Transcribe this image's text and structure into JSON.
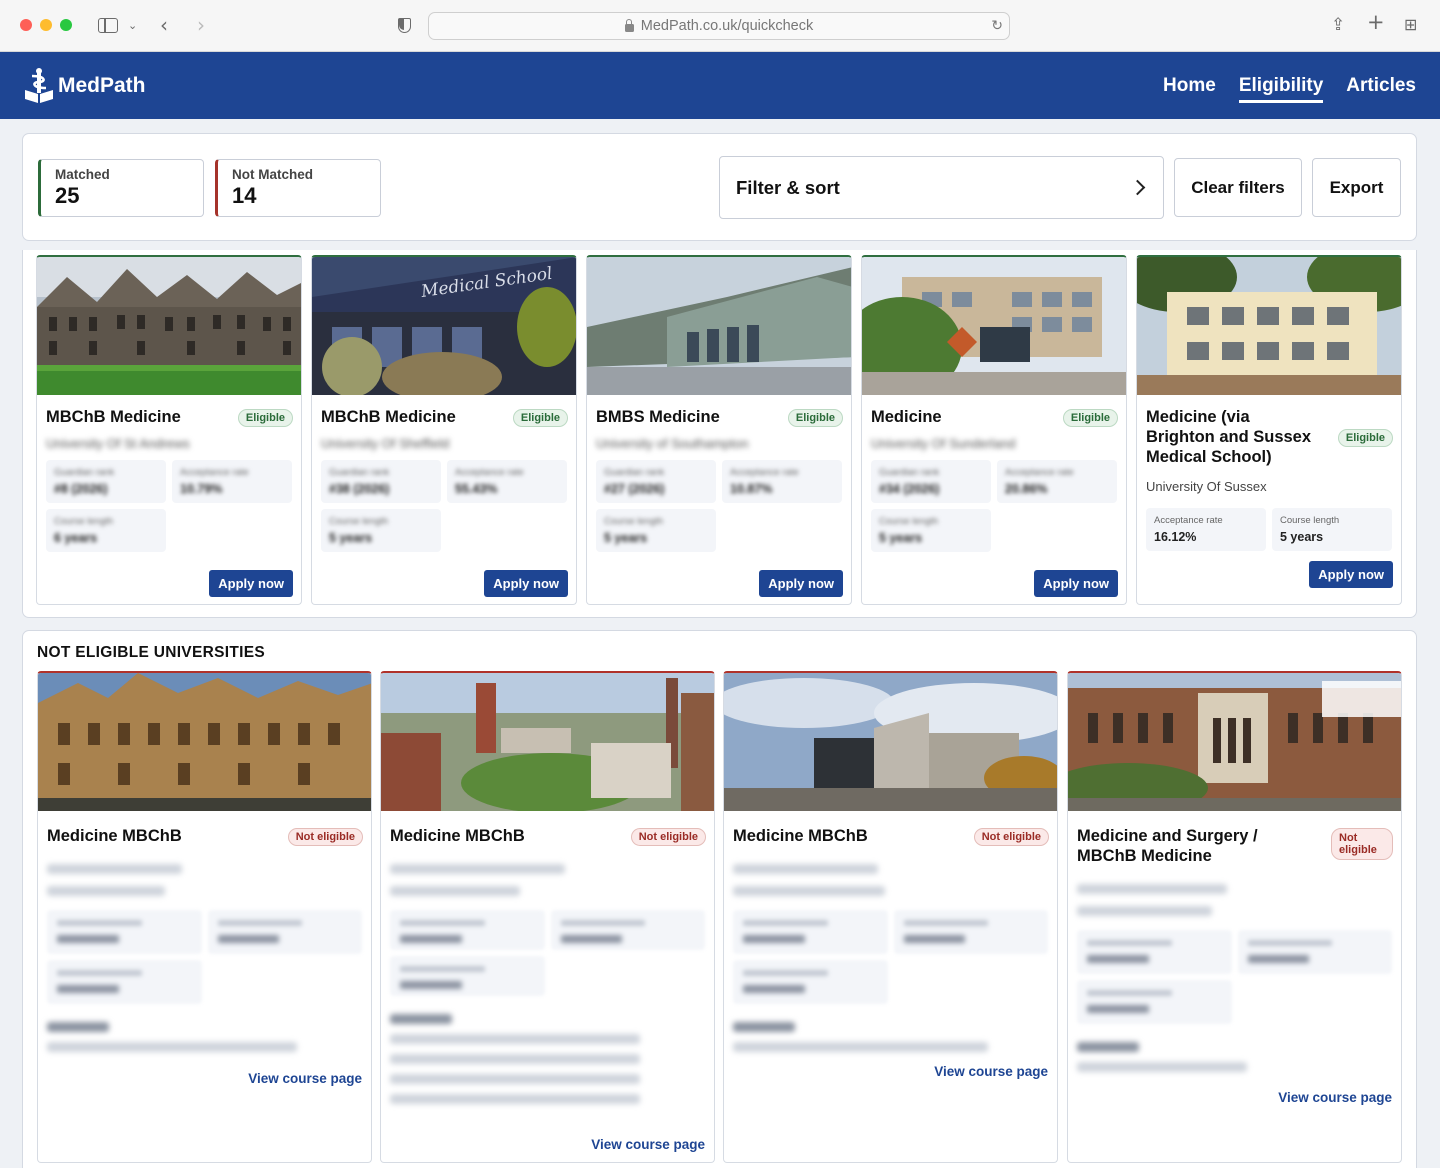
{
  "browser": {
    "url": "MedPath.co.uk/quickcheck"
  },
  "nav": {
    "brand": "MedPath",
    "links": [
      "Home",
      "Eligibility",
      "Articles"
    ],
    "active": "Eligibility"
  },
  "summary": {
    "matched_label": "Matched",
    "matched_count": "25",
    "not_matched_label": "Not Matched",
    "not_matched_count": "14",
    "filter_label": "Filter & sort",
    "clear_label": "Clear filters",
    "export_label": "Export"
  },
  "colors": {
    "brand_blue": "#1e4593",
    "eligible_green": "#2f6e3f",
    "not_eligible_red": "#b0322a"
  },
  "eligible": [
    {
      "title": "MBChB Medicine",
      "badge": "Eligible",
      "university": "University Of St Andrews",
      "metrics": [
        {
          "label": "Guardian rank",
          "value": "#8 (2026)"
        },
        {
          "label": "Acceptance rate",
          "value": "10.79%"
        },
        {
          "label": "Course length",
          "value": "6 years"
        }
      ],
      "action": "Apply now"
    },
    {
      "title": "MBChB Medicine",
      "badge": "Eligible",
      "university": "University Of Sheffield",
      "metrics": [
        {
          "label": "Guardian rank",
          "value": "#38 (2026)"
        },
        {
          "label": "Acceptance rate",
          "value": "55.43%"
        },
        {
          "label": "Course length",
          "value": "5 years"
        }
      ],
      "action": "Apply now"
    },
    {
      "title": "BMBS Medicine",
      "badge": "Eligible",
      "university": "University of Southampton",
      "metrics": [
        {
          "label": "Guardian rank",
          "value": "#27 (2026)"
        },
        {
          "label": "Acceptance rate",
          "value": "10.87%"
        },
        {
          "label": "Course length",
          "value": "5 years"
        }
      ],
      "action": "Apply now"
    },
    {
      "title": "Medicine",
      "badge": "Eligible",
      "university": "University Of Sunderland",
      "metrics": [
        {
          "label": "Guardian rank",
          "value": "#34 (2026)"
        },
        {
          "label": "Acceptance rate",
          "value": "20.86%"
        },
        {
          "label": "Course length",
          "value": "5 years"
        }
      ],
      "action": "Apply now"
    },
    {
      "title": "Medicine (via Brighton and Sussex Medical School)",
      "badge": "Eligible",
      "university": "University Of Sussex",
      "metrics": [
        {
          "label": "Acceptance rate",
          "value": "16.12%"
        },
        {
          "label": "Course length",
          "value": "5 years"
        }
      ],
      "action": "Apply now"
    }
  ],
  "not_eligible": {
    "heading": "NOT ELIGIBLE UNIVERSITIES",
    "cards": [
      {
        "title": "Medicine MBChB",
        "badge": "Not eligible",
        "action": "View course page"
      },
      {
        "title": "Medicine MBChB",
        "badge": "Not eligible",
        "action": "View course page"
      },
      {
        "title": "Medicine MBChB",
        "badge": "Not eligible",
        "action": "View course page"
      },
      {
        "title": "Medicine and Surgery / MBChB Medicine",
        "badge": "Not eligible",
        "action": "View course page"
      }
    ]
  }
}
